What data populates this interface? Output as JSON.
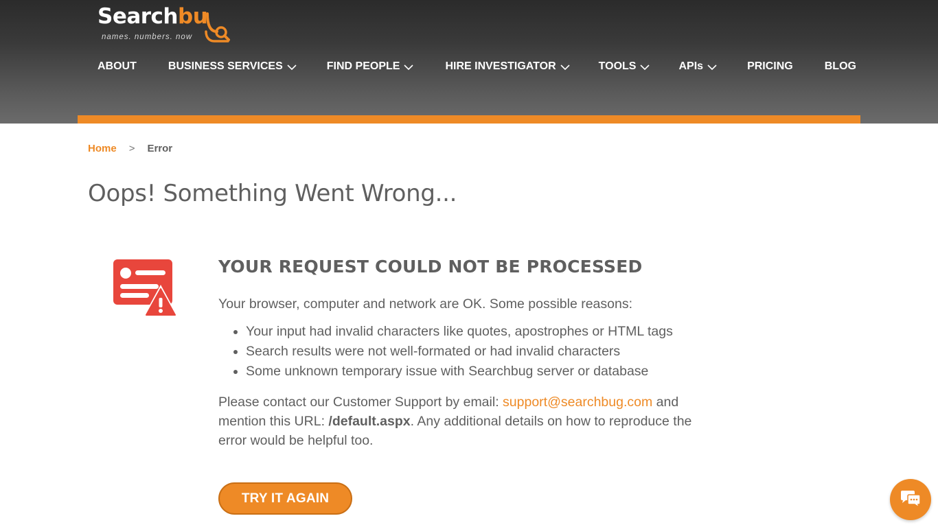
{
  "brand": {
    "name_part1": "Search",
    "name_part2": "bu",
    "tagline": "names. numbers. now",
    "accent_color": "#ee8a26"
  },
  "nav": {
    "items": [
      {
        "label": "ABOUT",
        "has_dropdown": false
      },
      {
        "label": "BUSINESS SERVICES",
        "has_dropdown": true
      },
      {
        "label": "FIND PEOPLE",
        "has_dropdown": true
      },
      {
        "label": "HIRE INVESTIGATOR",
        "has_dropdown": true
      },
      {
        "label": "TOOLS",
        "has_dropdown": true
      },
      {
        "label": "APIs",
        "has_dropdown": true
      },
      {
        "label": "PRICING",
        "has_dropdown": false
      },
      {
        "label": "BLOG",
        "has_dropdown": false
      }
    ]
  },
  "breadcrumb": {
    "home": "Home",
    "separator": ">",
    "current": "Error"
  },
  "page_title": "Oops! Something Went Wrong...",
  "error": {
    "icon": "error-document-warning-icon",
    "icon_color": "#e8463c",
    "heading": "YOUR REQUEST COULD NOT BE PROCESSED",
    "intro": "Your browser, computer and network are OK. Some possible reasons:",
    "reasons": [
      "Your input had invalid characters like quotes, apostrophes or HTML tags",
      "Search results were not well-formated or had invalid characters",
      "Some unknown temporary issue with Searchbug server or database"
    ],
    "contact_prefix": "Please contact our Customer Support by email:",
    "contact_email": "support@searchbug.com",
    "contact_mid": "and mention this URL:",
    "contact_url": "/default.aspx",
    "contact_suffix": ". Any additional details on how to reproduce the error would be helpful too."
  },
  "try_again_label": "TRY IT AGAIN",
  "chat": {
    "icon": "chat-bubbles-icon"
  }
}
